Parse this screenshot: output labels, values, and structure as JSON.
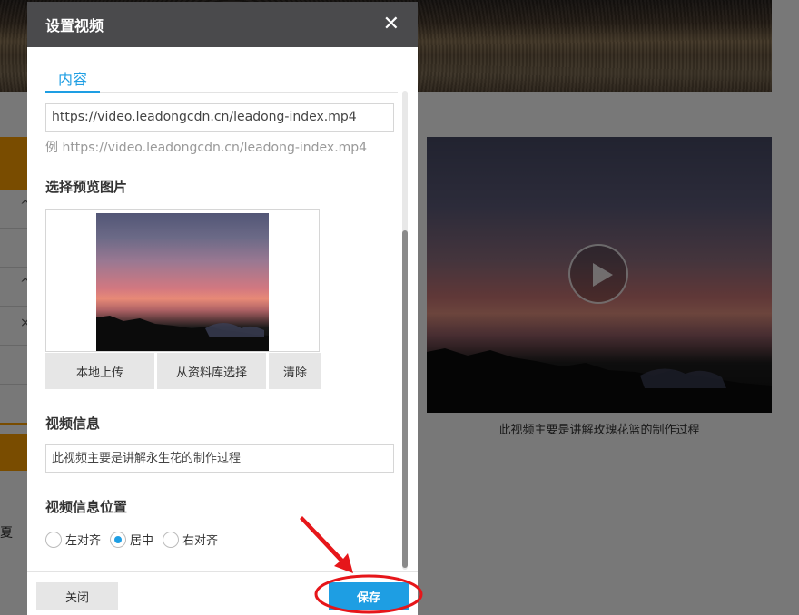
{
  "background": {
    "video_caption": "此视频主要是讲解玫瑰花篮的制作过程",
    "left_partial_text": "夏"
  },
  "dialog": {
    "title": "设置视频",
    "close_glyph": "✕",
    "tab_content": "内容",
    "video_url": "https://video.leadongcdn.cn/leadong-index.mp4",
    "url_example": "例 https://video.leadongcdn.cn/leadong-index.mp4",
    "preview_label": "选择预览图片",
    "buttons": {
      "local_upload": "本地上传",
      "from_library": "从资料库选择",
      "clear": "清除"
    },
    "info_label": "视频信息",
    "info_value": "此视频主要是讲解永生花的制作过程",
    "position_label": "视频信息位置",
    "position_options": [
      "左对齐",
      "居中",
      "右对齐"
    ],
    "position_selected": "居中",
    "footer": {
      "close": "关闭",
      "save": "保存"
    }
  },
  "colors": {
    "accent": "#1e9ee3",
    "header_bg": "#4a4a4c",
    "annotation": "#e6161a",
    "side_strip": "#f39800"
  }
}
